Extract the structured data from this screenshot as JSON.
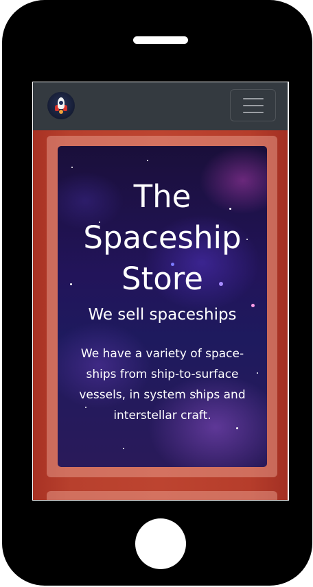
{
  "device": {
    "frame": "mobile-phone-mockup"
  },
  "navbar": {
    "brand_icon": "rocket-icon",
    "toggler_icon": "hamburger-menu-icon"
  },
  "hero": {
    "title": "The Spaceship Store",
    "subtitle": "We sell spaceships",
    "description": "We have a variety of space-ships from ship-to-surface vessels, in system ships and interstellar craft."
  },
  "colors": {
    "navbar_bg": "#343a40",
    "page_bg": "#b0382a",
    "text": "#ffffff"
  }
}
